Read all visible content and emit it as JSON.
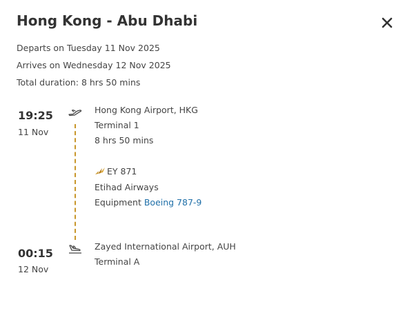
{
  "dialog": {
    "title": "Hong Kong - Abu Dhabi",
    "close_icon": "close-icon"
  },
  "summary": {
    "departs": "Departs on Tuesday 11 Nov 2025",
    "arrives": "Arrives on Wednesday 12 Nov 2025",
    "duration": "Total duration: 8 hrs 50 mins"
  },
  "departure": {
    "time": "19:25",
    "date": "11 Nov",
    "airport": "Hong Kong Airport, HKG",
    "terminal": "Terminal 1",
    "leg_duration": "8 hrs 50 mins",
    "icon": "takeoff-icon"
  },
  "flight": {
    "airline_icon": "etihad-logo-icon",
    "number": "EY 871",
    "airline": "Etihad Airways",
    "equipment_label": "Equipment",
    "equipment_value": "Boeing 787-9"
  },
  "arrival": {
    "time": "00:15",
    "date": "12 Nov",
    "airport": "Zayed International Airport, AUH",
    "terminal": "Terminal A",
    "icon": "landing-icon"
  },
  "colors": {
    "accent": "#c8962a",
    "link": "#1f6fa8"
  }
}
